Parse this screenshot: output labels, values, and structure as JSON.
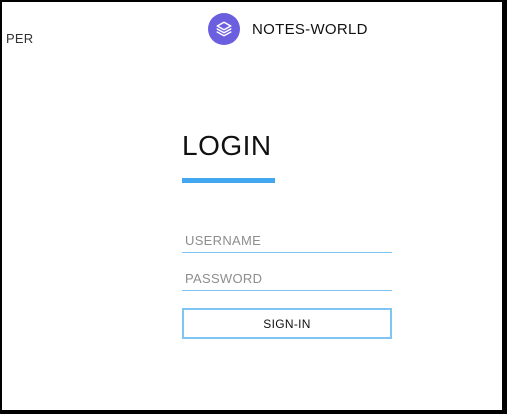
{
  "header": {
    "left_text": "PER",
    "brand_name": "NOTES-WORLD",
    "brand_icon": "layers-icon"
  },
  "login": {
    "title": "LOGIN",
    "username_placeholder": "USERNAME",
    "password_placeholder": "PASSWORD",
    "username_value": "",
    "password_value": "",
    "signin_label": "SIGN-IN"
  },
  "colors": {
    "accent": "#43a7ef",
    "field_border": "#7fc4f3",
    "brand": "#6b5fe0"
  }
}
